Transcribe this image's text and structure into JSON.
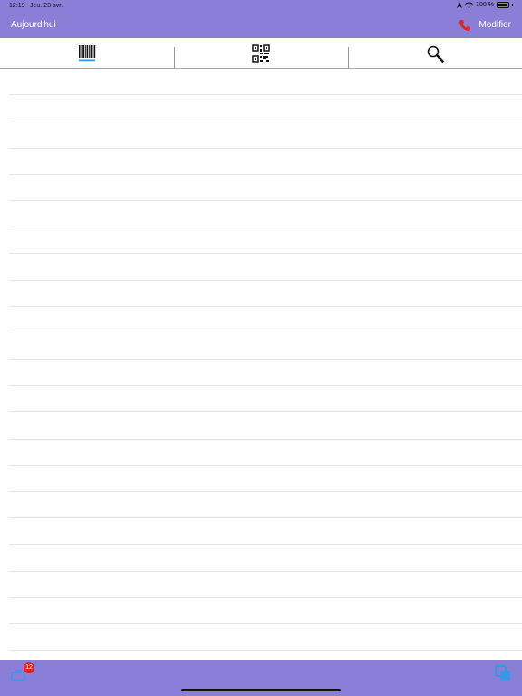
{
  "status_bar": {
    "time": "12:19",
    "date": "Jeu. 23 avr.",
    "battery": "100 %"
  },
  "nav": {
    "left_label": "Aujourd'hui",
    "right_label": "Modifier"
  },
  "tabs": [
    {
      "icon": "barcode-icon",
      "selected": true
    },
    {
      "icon": "qr-code-icon",
      "selected": false
    },
    {
      "icon": "search-icon",
      "selected": false
    }
  ],
  "list": {
    "row_count": 22
  },
  "toolbar": {
    "badge_count": "12"
  },
  "colors": {
    "bar_background": "#8A7FD6",
    "accent_red": "#E8231B",
    "accent_blue": "#2E9BE8"
  }
}
